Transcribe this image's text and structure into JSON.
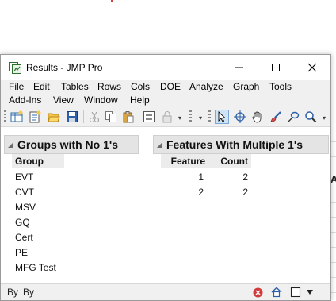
{
  "window": {
    "title": "Results - JMP Pro"
  },
  "menubar": {
    "items": [
      "File",
      "Edit",
      "Tables",
      "Rows",
      "Cols",
      "DOE",
      "Analyze",
      "Graph",
      "Tools",
      "Add-Ins",
      "View",
      "Window",
      "Help"
    ]
  },
  "toolbar": {
    "icons": [
      "new-table-icon",
      "new-script-icon",
      "open-icon",
      "save-icon",
      "cut-icon",
      "copy-icon",
      "paste-icon",
      "journal-icon",
      "lock-icon",
      "arrow-icon",
      "crosshair-icon",
      "hand-icon",
      "brush-icon",
      "lasso-icon",
      "zoom-icon"
    ]
  },
  "report": {
    "groups_no_ones": {
      "title": "Groups with No 1's",
      "column": "Group",
      "rows": [
        "EVT",
        "CVT",
        "MSV",
        "GQ",
        "Cert",
        "PE",
        "MFG Test"
      ]
    },
    "features_multiple": {
      "title": "Features With Multiple 1's",
      "columns": [
        "Feature",
        "Count"
      ],
      "rows": [
        {
          "feature": "1",
          "count": "2"
        },
        {
          "feature": "2",
          "count": "2"
        }
      ]
    }
  },
  "statusbar": {
    "left_text": "By",
    "by_text": "By"
  },
  "background": {
    "partial_letter": "A"
  }
}
